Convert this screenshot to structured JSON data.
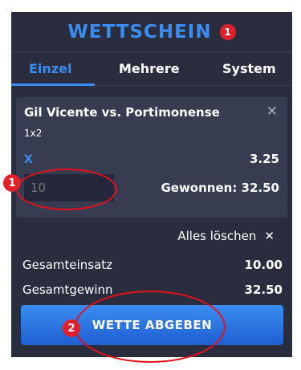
{
  "header": {
    "title": "WETTSCHEIN",
    "badge": "1"
  },
  "tabs": [
    {
      "label": "Einzel",
      "active": true
    },
    {
      "label": "Mehrere",
      "active": false
    },
    {
      "label": "System",
      "active": false
    }
  ],
  "bet": {
    "match": "Gil Vicente vs. Portimonense",
    "market": "1x2",
    "selection": "X",
    "odds": "3.25",
    "stake_placeholder": "10",
    "winnings": "Gewonnen: 32.50"
  },
  "clear_all": "Alles löschen",
  "summary": {
    "total_stake_label": "Gesamteinsatz",
    "total_stake_value": "10.00",
    "total_win_label": "Gesamtgewinn",
    "total_win_value": "32.50"
  },
  "submit_label": "WETTE ABGEBEN",
  "annotations": {
    "one": "1",
    "two": "2"
  },
  "colors": {
    "accent": "#3b8cf0",
    "panel": "#2a2d3e",
    "card": "#383c50",
    "annotation": "#e3111b"
  }
}
